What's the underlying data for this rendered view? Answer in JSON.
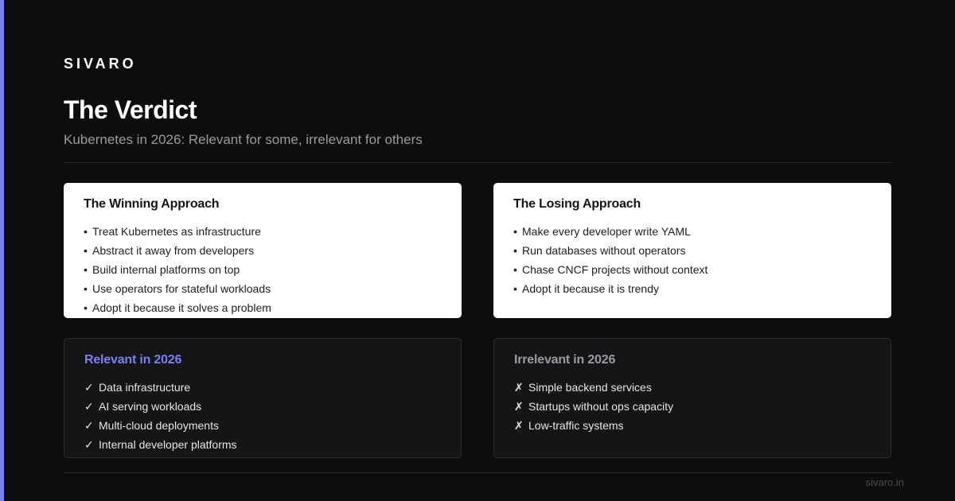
{
  "brand": "SIVARO",
  "title": "The Verdict",
  "subtitle": "Kubernetes in 2026: Relevant for some, irrelevant for others",
  "colors": {
    "accent": "#7b7ff2",
    "background": "#0d0d0d"
  },
  "winning": {
    "title": "The Winning Approach",
    "marker": "•",
    "items": [
      "Treat Kubernetes as infrastructure",
      "Abstract it away from developers",
      "Build internal platforms on top",
      "Use operators for stateful workloads",
      "Adopt it because it solves a problem"
    ]
  },
  "losing": {
    "title": "The Losing Approach",
    "marker": "•",
    "items": [
      "Make every developer write YAML",
      "Run databases without operators",
      "Chase CNCF projects without context",
      "Adopt it because it is trendy"
    ]
  },
  "relevant": {
    "title": "Relevant in 2026",
    "marker": "✓",
    "items": [
      "Data infrastructure",
      "AI serving workloads",
      "Multi-cloud deployments",
      "Internal developer platforms"
    ]
  },
  "irrelevant": {
    "title": "Irrelevant in 2026",
    "marker": "✗",
    "items": [
      "Simple backend services",
      "Startups without ops capacity",
      "Low-traffic systems"
    ]
  },
  "footer": "sivaro.in"
}
